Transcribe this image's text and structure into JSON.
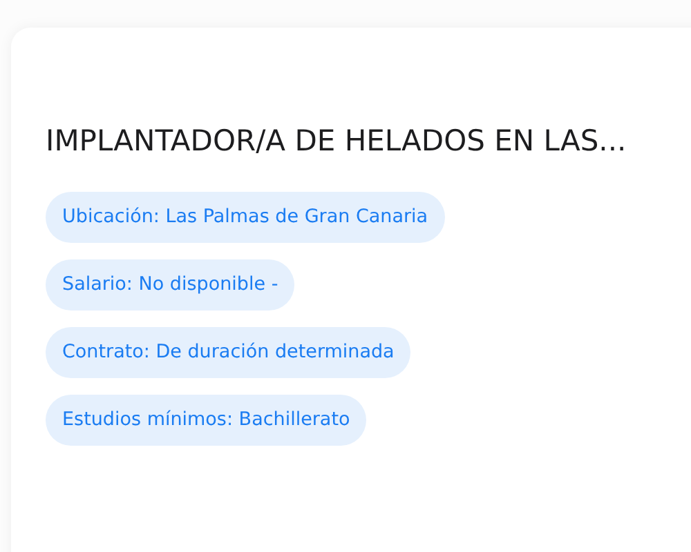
{
  "job": {
    "title": "IMPLANTADOR/A DE HELADOS EN LAS...",
    "tags": [
      {
        "text": "Ubicación: Las Palmas de Gran Canaria"
      },
      {
        "text": "Salario: No disponible -"
      },
      {
        "text": "Contrato: De duración determinada"
      },
      {
        "text": "Estudios mínimos: Bachillerato"
      }
    ]
  }
}
